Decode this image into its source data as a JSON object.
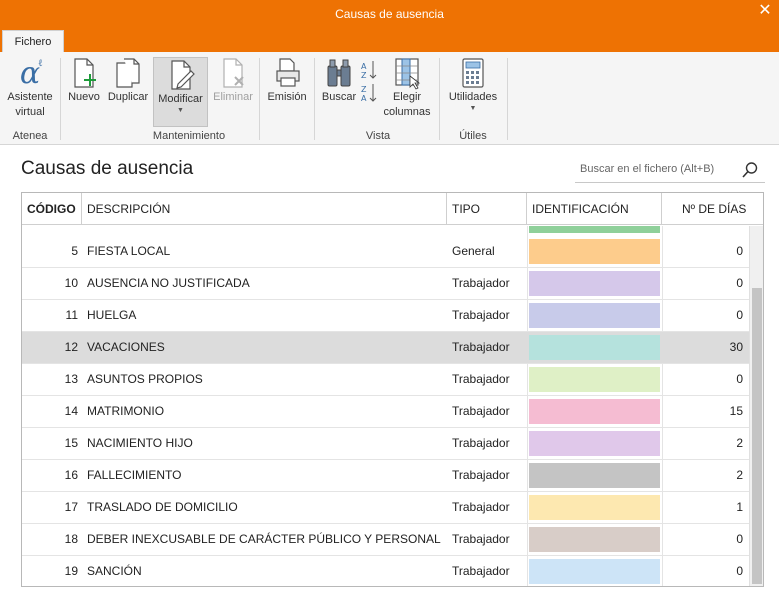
{
  "window": {
    "title": "Causas de ausencia",
    "close_icon": "close-icon"
  },
  "tabs": [
    {
      "label": "Fichero"
    }
  ],
  "ribbon": {
    "groups": [
      {
        "label": "Atenea"
      },
      {
        "label": "Mantenimiento"
      },
      {
        "label": "Vista"
      },
      {
        "label": "Útiles"
      }
    ],
    "buttons": {
      "asistente": {
        "label": "Asistente virtual",
        "line1": "Asistente",
        "line2": "virtual",
        "icon": "alpha-icon"
      },
      "nuevo": {
        "label": "Nuevo",
        "icon": "new-document-icon"
      },
      "duplicar": {
        "label": "Duplicar",
        "icon": "duplicate-icon"
      },
      "modificar": {
        "label": "Modificar",
        "icon": "edit-document-icon"
      },
      "eliminar": {
        "label": "Eliminar",
        "icon": "delete-document-icon"
      },
      "emision": {
        "label": "Emisión",
        "icon": "printer-icon"
      },
      "buscar": {
        "label": "Buscar",
        "icon": "binoculars-icon"
      },
      "sort_icon": "sort-az-icon",
      "elegir": {
        "label": "Elegir columnas",
        "line1": "Elegir",
        "line2": "columnas",
        "icon": "columns-icon"
      },
      "utilidades": {
        "label": "Utilidades",
        "icon": "calculator-icon"
      }
    }
  },
  "page": {
    "title": "Causas de ausencia",
    "search": {
      "placeholder": "Buscar en el fichero (Alt+B)",
      "icon": "search-icon"
    }
  },
  "grid": {
    "columns": [
      "CÓDIGO",
      "DESCRIPCIÓN",
      "TIPO",
      "IDENTIFICACIÓN",
      "Nº DE DÍAS"
    ],
    "sorted_column": "CÓDIGO",
    "top_partial_color": "#8fd09a",
    "rows": [
      {
        "codigo": "5",
        "descripcion": "FIESTA LOCAL",
        "tipo": "General",
        "color": "#fdcc8c",
        "dias": "0"
      },
      {
        "codigo": "10",
        "descripcion": "AUSENCIA NO JUSTIFICADA",
        "tipo": "Trabajador",
        "color": "#d5c8ea",
        "dias": "0"
      },
      {
        "codigo": "11",
        "descripcion": "HUELGA",
        "tipo": "Trabajador",
        "color": "#c8cbea",
        "dias": "0"
      },
      {
        "codigo": "12",
        "descripcion": "VACACIONES",
        "tipo": "Trabajador",
        "color": "#b5e2dd",
        "dias": "30",
        "selected": true
      },
      {
        "codigo": "13",
        "descripcion": "ASUNTOS PROPIOS",
        "tipo": "Trabajador",
        "color": "#dff0c6",
        "dias": "0"
      },
      {
        "codigo": "14",
        "descripcion": "MATRIMONIO",
        "tipo": "Trabajador",
        "color": "#f5bcd2",
        "dias": "15"
      },
      {
        "codigo": "15",
        "descripcion": "NACIMIENTO HIJO",
        "tipo": "Trabajador",
        "color": "#e0c8ea",
        "dias": "2"
      },
      {
        "codigo": "16",
        "descripcion": "FALLECIMIENTO",
        "tipo": "Trabajador",
        "color": "#c4c4c4",
        "dias": "2"
      },
      {
        "codigo": "17",
        "descripcion": "TRASLADO DE DOMICILIO",
        "tipo": "Trabajador",
        "color": "#fde8b0",
        "dias": "1"
      },
      {
        "codigo": "18",
        "descripcion": "DEBER INEXCUSABLE DE CARÁCTER PÚBLICO Y PERSONAL",
        "tipo": "Trabajador",
        "color": "#d8cdc8",
        "dias": "0"
      },
      {
        "codigo": "19",
        "descripcion": "SANCIÓN",
        "tipo": "Trabajador",
        "color": "#cde4f7",
        "dias": "0"
      }
    ]
  },
  "colors": {
    "accent": "#ee7203",
    "ribbon_bg": "#f5f5f5",
    "selected_row": "#dcdcdc"
  }
}
